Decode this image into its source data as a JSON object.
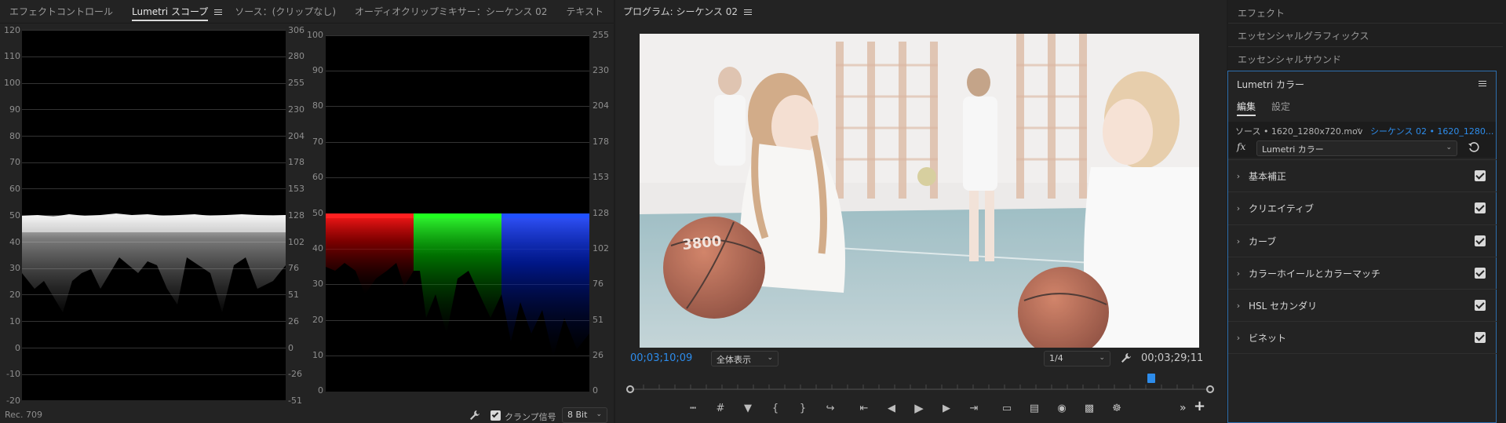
{
  "left_panel": {
    "tabs": [
      "エフェクトコントロール",
      "Lumetri スコープ",
      "ソース：(クリップなし)",
      "オーディオクリップミキサー：シーケンス 02",
      "テキスト"
    ],
    "active_tab": 1,
    "overflow": "»",
    "waveform": {
      "left_ticks": [
        "120",
        "110",
        "100",
        "90",
        "80",
        "70",
        "60",
        "50",
        "40",
        "30",
        "20",
        "10",
        "0",
        "-10",
        "-20"
      ],
      "right_ticks": [
        "306",
        "280",
        "255",
        "230",
        "204",
        "178",
        "153",
        "128",
        "102",
        "76",
        "51",
        "26",
        "0",
        "-26",
        "-51"
      ],
      "footer_label": "Rec. 709"
    },
    "parade": {
      "left_ticks": [
        "100",
        "90",
        "80",
        "70",
        "60",
        "50",
        "40",
        "30",
        "20",
        "10",
        "0"
      ],
      "right_ticks": [
        "255",
        "230",
        "204",
        "178",
        "153",
        "128",
        "102",
        "76",
        "51",
        "26",
        "0"
      ]
    },
    "footer": {
      "clamp_label": "クランプ信号",
      "bit_depth": "8 Bit"
    },
    "colors": {
      "red": "#d40000",
      "green": "#00c000",
      "blue": "#0030e0"
    }
  },
  "program": {
    "title": "プログラム: シーケンス 02",
    "timecode_current": "00;03;10;09",
    "zoom": "全体表示",
    "resolution": "1/4",
    "timecode_duration": "00;03;29;11",
    "playhead_fraction": 0.9,
    "accent": "#2d8ceb",
    "ball_text": "3800",
    "transport_icons": [
      "marker-in-icon",
      "marker-out-icon",
      "add-marker-icon",
      "mark-in-icon",
      "mark-out-icon",
      "export-frame-icon",
      "go-to-in-icon",
      "step-back-icon",
      "play-icon",
      "step-forward-icon",
      "go-to-out-icon",
      "lift-icon",
      "extract-icon",
      "camera-icon",
      "compare-icon",
      "safe-margins-icon"
    ],
    "overflow": "»",
    "add": "+"
  },
  "right_panel": {
    "effects": "エフェクト",
    "essential_graphics": "エッセンシャルグラフィックス",
    "essential_sound": "エッセンシャルサウンド",
    "lumetri_title": "Lumetri カラー",
    "tabs": [
      "編集",
      "設定"
    ],
    "source_label": "ソース • 1620_1280x720.mov",
    "sequence_label": "シーケンス 02 • 1620_1280...",
    "fx": "fx",
    "effect_select": "Lumetri カラー",
    "sections": [
      "基本補正",
      "クリエイティブ",
      "カーブ",
      "カラーホイールとカラーマッチ",
      "HSL セカンダリ",
      "ビネット"
    ]
  }
}
